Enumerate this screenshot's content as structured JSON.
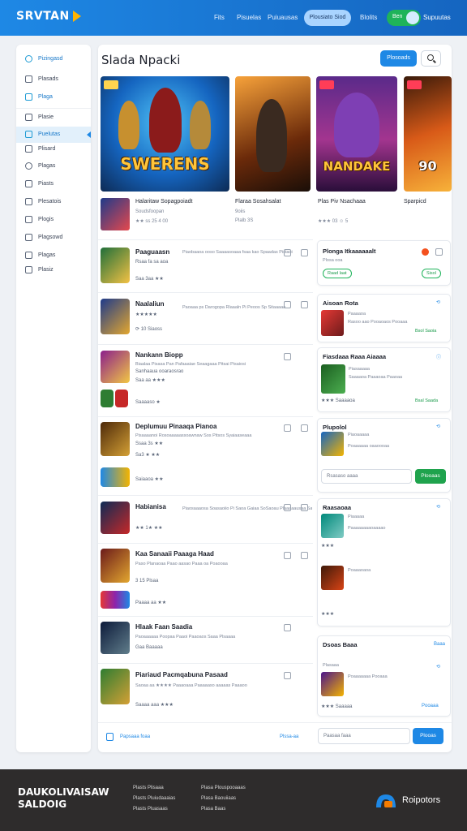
{
  "header": {
    "logo": "SRVTAN",
    "nav": [
      "Fits",
      "Pisuelas",
      "Puiuausas"
    ],
    "pill": "Plousiato Siod",
    "link": "Blolits",
    "toggle_label": "Ben",
    "user": "Supuutas"
  },
  "sidebar": {
    "items": [
      {
        "label": "Pizingasd"
      },
      {
        "label": "Plasads"
      },
      {
        "label": "Plaga"
      },
      {
        "label": "Plasie"
      },
      {
        "label": "Puelutas"
      },
      {
        "label": "Plisard"
      },
      {
        "label": "Plagas"
      },
      {
        "label": "Piasts"
      },
      {
        "label": "Plesatois"
      },
      {
        "label": "Plogis"
      },
      {
        "label": "Plagsowd"
      },
      {
        "label": "Plagas"
      },
      {
        "label": "Plasiz"
      }
    ]
  },
  "main": {
    "title": "Slada Npacki",
    "primary_btn": "Plosoads",
    "featured": [
      {
        "art": "SWERENS",
        "title": "Halaritaw Sopagpoiadt",
        "sub": "Soudsfoopan",
        "meta": "★★ ss 25 4 00"
      },
      {
        "art": "",
        "title": "Flaraa Sosahsalat",
        "sub": "9oiis",
        "meta": "Plalb 3S"
      },
      {
        "art": "NANDAKE",
        "title": "Plas Piv Nsachaaa",
        "sub": "",
        "meta": "★★★ 03 ☺ 5"
      },
      {
        "art": "90",
        "title": "Sparpicd",
        "sub": "",
        "meta": ""
      }
    ],
    "rows": [
      {
        "title": "Paaguaasn",
        "desc": "Piaobaaoa ooso Saaaasoaaa fsaa kao Spaadas Pistaoi",
        "meta1": "Rsaa fa sa aoa",
        "meta2": "Saa 3aa ★★"
      },
      {
        "title": "Naalaliun",
        "desc": "Paoaaa ps Darogopa Rlaaaln Pi Peoos Sp Sitaaaaa",
        "meta1": "★★★★★",
        "meta2": "⟳ 10 Siaoss"
      },
      {
        "title": "Nankann Biopp",
        "desc": "Biaalaa Pisasa Pan Pafaaaiae Seaagaaa Pitsai Pisaiosi",
        "meta1": "Sanhaaua ooaraosrao",
        "meta2": "Saa aa ★★★",
        "meta3": "Saaaaso ★"
      },
      {
        "title": "Deplumuu Pinaaqa Pianoa",
        "desc": "Pisaaaanoi Rosoaaaaassoawnaw Sos Pitsos Syaiaaseaaa",
        "meta1": "Ssaa 3s ★★",
        "meta2": "Sa3 ★ ★★",
        "meta3": "Saiaaoa ★★"
      },
      {
        "title": "Habianisa",
        "desc": "Piaosaaaosa Soasaoiio Pi Saoa Gaiaa SoSaoau Plaaaaausaa Sawisasag",
        "meta1": "★★ 1★ ★★"
      },
      {
        "title": "Kaa Sanaaii Paaaga Haad",
        "desc": "Paso Planaoaa Paao aasao Paaa oa Poaooaa",
        "meta1": "3 15 Plsaa",
        "meta2": "Paaaa aa ★★"
      },
      {
        "title": "Hlaak Faan Saadia",
        "desc": "Paoaaaaaa Poopaa Paaoi Paaoaos Saaa Plsaaaa",
        "meta1": "Gaa Baaaaa"
      },
      {
        "title": "Piariaud Pacmqabuna Pasaad",
        "desc": "Saoaa aa ★★★★ Paaaoaaa Paaaaaso aaaaas Paaaoo",
        "meta1": "Saaaa aaa ★★★"
      }
    ],
    "cards": [
      {
        "title": "Plonga Itkaaaaaalt",
        "sub": "Plosa ooa",
        "pill": "Raad laat",
        "pill2": "Sisol"
      },
      {
        "title": "Aisoan Rota",
        "sub1": "Paaaaoa",
        "sub2": "Rasoo aao Pooaoaos Pooaaa",
        "green": "Bsol Saoia"
      },
      {
        "title": "Fiasdaaa Raaa Aiaaaa",
        "sub1": "Piasaaaaa",
        "sub2": "Saaaaoa Paaaoaa Paaoaa",
        "meta": "★★★ Saaaaoa",
        "green": "Bsal Saada"
      },
      {
        "title": "Plupolol",
        "sub1": "Piaoaaaaa",
        "sub2": "Poaaaaaa oaaoooaa",
        "input": "Rsasaso aaaa",
        "btn": "Plooaas"
      },
      {
        "title": "Raasaoaa",
        "sub1": "Piaaaaa",
        "sub2": "Paaaaaaaaoaaaao",
        "meta": "★★★",
        "title2": "Poaaaoaoa",
        "meta2": "★★★"
      },
      {
        "title": "Dsoas Baaa",
        "link": "Baaa",
        "title2": "Plasaaa",
        "sub2": "Poaaaaaaa Pooaaa",
        "meta2": "★★★ Saaaaa",
        "link2": "Pooaaa"
      }
    ],
    "bottom": {
      "label": "Papsaaa foaa",
      "link": "Plssa-aa",
      "input": "Paasaa faaa",
      "btn": "Plooas"
    }
  },
  "footer": {
    "brand_line1": "DAUKOLIVAISAW",
    "brand_line2": "SALDOIG",
    "links": [
      "Plasts Plisaaa",
      "Plasts Pluiudaaaias",
      "Plasts Pluasaas",
      "Plasa Plouspooaaas",
      "Plasa Baouiiaas",
      "Plasa Baas"
    ],
    "company": "Roipotors"
  }
}
